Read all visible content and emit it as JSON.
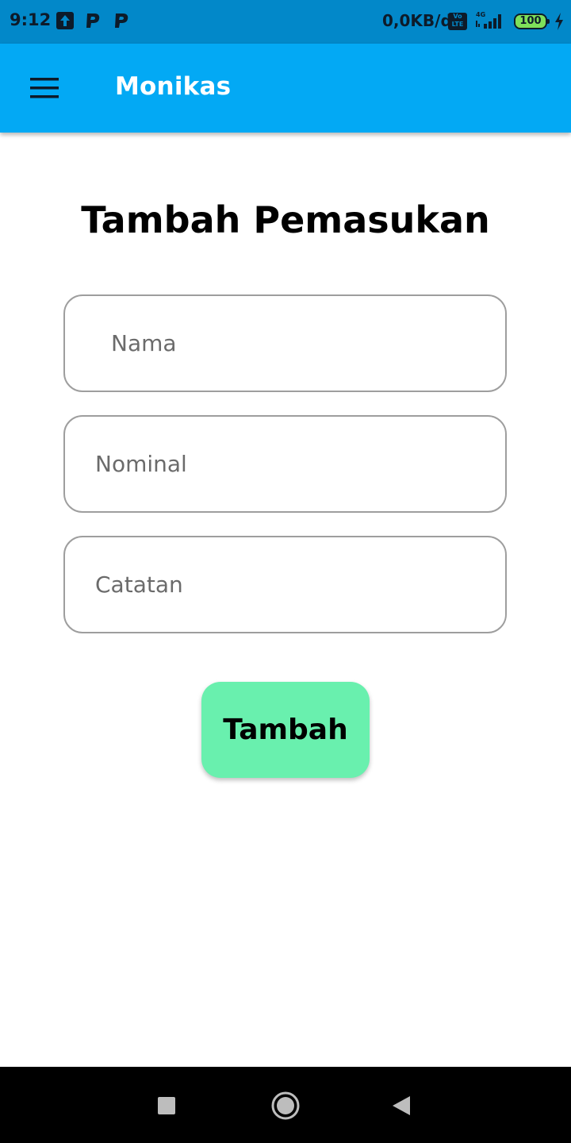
{
  "status_bar": {
    "time": "9:12",
    "network_speed": "0,0KB/d",
    "volte_label": "Vo LTE",
    "network_type": "4G",
    "battery_level": "100"
  },
  "app_bar": {
    "title": "Monikas",
    "menu_icon": "hamburger-menu-icon",
    "background_color": "#03a9f4"
  },
  "form": {
    "title": "Tambah Pemasukan",
    "fields": [
      {
        "name": "nama",
        "placeholder": "Nama",
        "value": ""
      },
      {
        "name": "nominal",
        "placeholder": "Nominal",
        "value": ""
      },
      {
        "name": "catatan",
        "placeholder": "Catatan",
        "value": ""
      }
    ],
    "submit_label": "Tambah",
    "submit_color": "#69f0ae"
  },
  "nav_bar": {
    "buttons": [
      "recents-icon",
      "home-icon",
      "back-icon"
    ]
  }
}
